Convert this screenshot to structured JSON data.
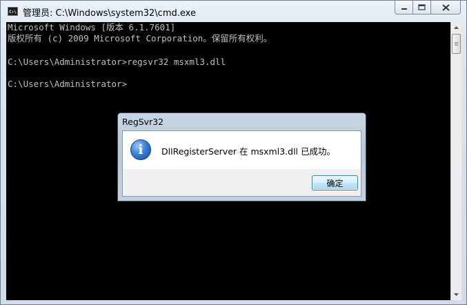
{
  "window": {
    "title": "管理员: C:\\Windows\\system32\\cmd.exe",
    "icon_label": "C:\\",
    "buttons": {
      "minimize": "minimize-icon",
      "maximize": "maximize-icon",
      "close": "close-icon"
    }
  },
  "console": {
    "lines": [
      "Microsoft Windows [版本 6.1.7601]",
      "版权所有 (c) 2009 Microsoft Corporation。保留所有权利。",
      "",
      "C:\\Users\\Administrator>regsvr32 msxml3.dll",
      "",
      "C:\\Users\\Administrator>"
    ],
    "colors": {
      "background": "#000000",
      "text": "#c0c0c0"
    }
  },
  "dialog": {
    "title": "RegSvr32",
    "icon": "info-icon",
    "icon_glyph": "i",
    "message": "DllRegisterServer 在 msxml3.dll 已成功。",
    "ok_label": "确定"
  }
}
